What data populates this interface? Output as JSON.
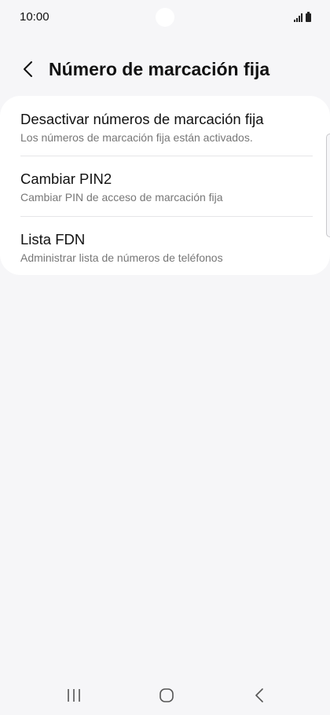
{
  "status_bar": {
    "time": "10:00"
  },
  "header": {
    "back_icon": "chevron-left-icon",
    "title": "Número de marcación fija"
  },
  "list": {
    "items": [
      {
        "title": "Desactivar números de marcación fija",
        "subtitle": "Los números de marcación fija están activados."
      },
      {
        "title": "Cambiar PIN2",
        "subtitle": "Cambiar PIN de acceso de marcación fija"
      },
      {
        "title": "Lista FDN",
        "subtitle": "Administrar lista de números de teléfonos"
      }
    ]
  },
  "nav_bar": {
    "recent_icon": "recent-apps-icon",
    "home_icon": "home-icon",
    "back_icon": "back-icon"
  },
  "colors": {
    "background": "#f6f6f8",
    "card": "#ffffff",
    "text_primary": "#111111",
    "text_secondary": "#777777"
  }
}
